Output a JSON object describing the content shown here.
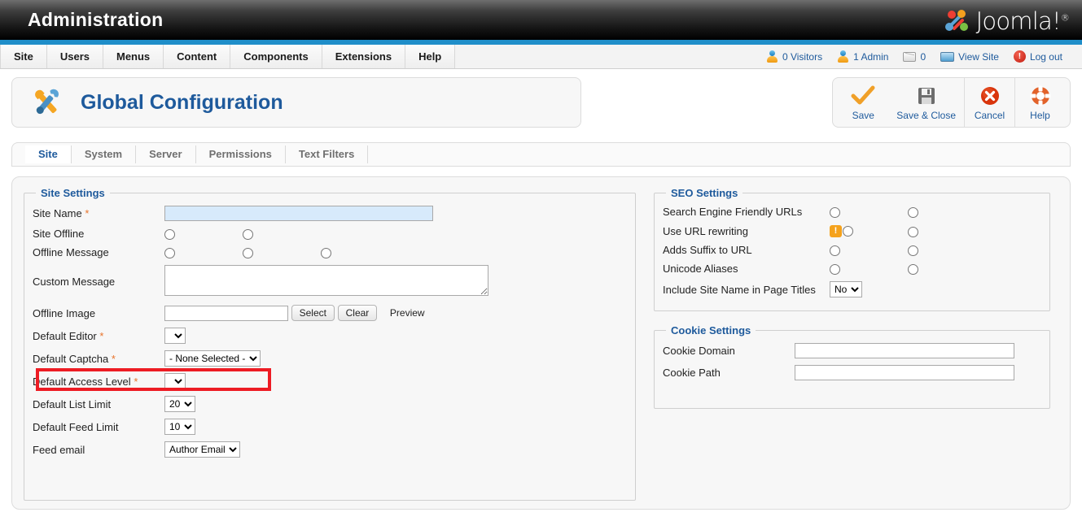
{
  "header": {
    "title": "Administration",
    "brand": "Joomla!",
    "brand_sup": "®"
  },
  "menu": {
    "items": [
      {
        "label": "Site"
      },
      {
        "label": "Users"
      },
      {
        "label": "Menus"
      },
      {
        "label": "Content"
      },
      {
        "label": "Components"
      },
      {
        "label": "Extensions"
      },
      {
        "label": "Help"
      }
    ],
    "status": {
      "visitors": "0 Visitors",
      "admins": "1 Admin",
      "messages": "0",
      "view_site": "View Site",
      "logout": "Log out",
      "logout_glyph": "!"
    }
  },
  "page": {
    "title": "Global Configuration",
    "toolbar": [
      {
        "label": "Save",
        "icon": "checkmark-icon"
      },
      {
        "label": "Save & Close",
        "icon": "floppy-disk-icon"
      },
      {
        "label": "Cancel",
        "icon": "red-x-circle-icon"
      },
      {
        "label": "Help",
        "icon": "lifering-icon"
      }
    ]
  },
  "tabs": [
    {
      "label": "Site",
      "active": true
    },
    {
      "label": "System",
      "active": false
    },
    {
      "label": "Server",
      "active": false
    },
    {
      "label": "Permissions",
      "active": false
    },
    {
      "label": "Text Filters",
      "active": false
    }
  ],
  "site_settings": {
    "legend": "Site Settings",
    "site_name": {
      "label": "Site Name",
      "required": "*",
      "value": "",
      "placeholder": ""
    },
    "site_offline": {
      "label": "Site Offline",
      "options": 2
    },
    "offline_message": {
      "label": "Offline Message",
      "options": 3
    },
    "custom_message": {
      "label": "Custom Message",
      "value": ""
    },
    "offline_image": {
      "label": "Offline Image",
      "value": "",
      "select_button": "Select",
      "clear_button": "Clear",
      "preview_label": "Preview"
    },
    "default_editor": {
      "label": "Default Editor",
      "required": "*",
      "value": ""
    },
    "default_captcha": {
      "label": "Default Captcha",
      "required": "*",
      "value": "- None Selected -",
      "highlighted": true
    },
    "default_access_level": {
      "label": "Default Access Level",
      "required": "*",
      "value": ""
    },
    "default_list_limit": {
      "label": "Default List Limit",
      "value": "20"
    },
    "default_feed_limit": {
      "label": "Default Feed Limit",
      "value": "10"
    },
    "feed_email": {
      "label": "Feed email",
      "value": "Author Email"
    }
  },
  "seo_settings": {
    "legend": "SEO Settings",
    "rows": [
      {
        "label": "Search Engine Friendly URLs",
        "warn": false
      },
      {
        "label": "Use URL rewriting",
        "warn": true,
        "warn_glyph": "!"
      },
      {
        "label": "Adds Suffix to URL",
        "warn": false
      },
      {
        "label": "Unicode Aliases",
        "warn": false
      }
    ],
    "include_site_name": {
      "label": "Include Site Name in Page Titles",
      "value": "No"
    }
  },
  "cookie_settings": {
    "legend": "Cookie Settings",
    "cookie_domain": {
      "label": "Cookie Domain",
      "value": ""
    },
    "cookie_path": {
      "label": "Cookie Path",
      "value": ""
    }
  },
  "colors": {
    "accent_blue": "#1f8ec9",
    "link_blue": "#1e5a9c",
    "highlight_red": "#ed1c24",
    "required_orange": "#e8742c",
    "input_highlight": "#d7eafb",
    "warn_orange": "#f5a21c"
  }
}
